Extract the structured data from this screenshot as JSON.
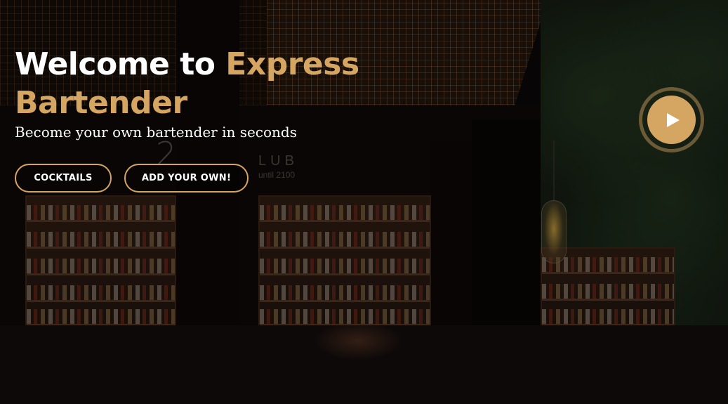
{
  "hero": {
    "title_white": "Welcome to ",
    "title_accent_1": "Express",
    "title_accent_2": "Bartender",
    "tagline": "Become your own bartender in seconds",
    "buttons": {
      "cocktails": "COCKTAILS",
      "add_your_own": "ADD YOUR OWN!"
    },
    "play_icon": "play-icon"
  },
  "background_signage": {
    "number": "2",
    "club": "LUB",
    "club_sub": "until 2100"
  },
  "colors": {
    "accent": "#d5a562",
    "text": "#ffffff",
    "footer_band": "#0d0909"
  }
}
